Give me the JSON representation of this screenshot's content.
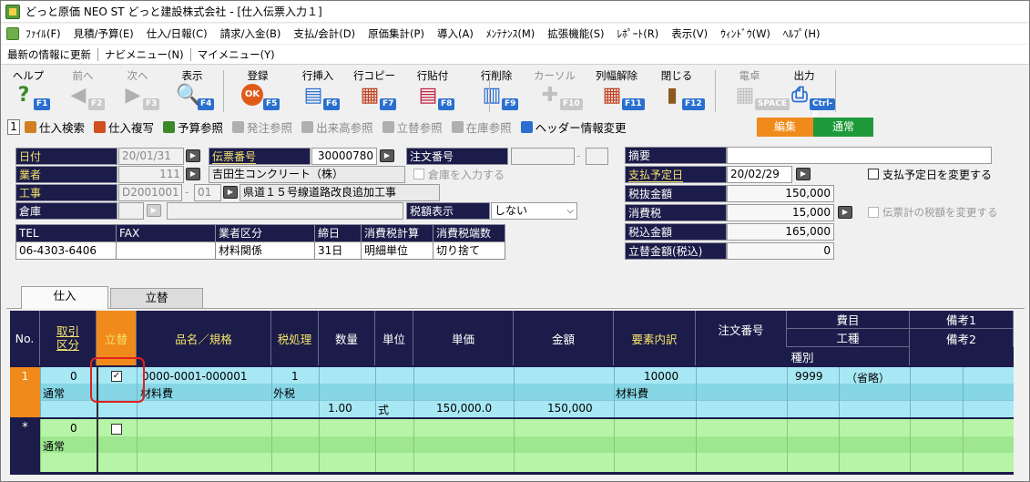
{
  "window": {
    "title": "どっと原価 NEO ST どっと建設株式会社 - [仕入伝票入力１]"
  },
  "menu": [
    "ﾌｧｲﾙ(F)",
    "見積/予算(E)",
    "仕入/日報(C)",
    "請求/入金(B)",
    "支払/会計(D)",
    "原価集計(P)",
    "導入(A)",
    "ﾒﾝﾃﾅﾝｽ(M)",
    "拡張機能(S)",
    "ﾚﾎﾟｰﾄ(R)",
    "表示(V)",
    "ｳｨﾝﾄﾞｳ(W)",
    "ﾍﾙﾌﾟ(H)"
  ],
  "links": [
    "最新の情報に更新",
    "ナビメニュー(N)",
    "マイメニュー(Y)"
  ],
  "toolbar": [
    {
      "label": "ヘルプ",
      "key": "F1",
      "icon": "?",
      "color": "#3a8a2a",
      "disabled": false
    },
    {
      "label": "前へ",
      "key": "F2",
      "icon": "◀",
      "color": "#b0b0b0",
      "disabled": true
    },
    {
      "label": "次へ",
      "key": "F3",
      "icon": "▶",
      "color": "#b0b0b0",
      "disabled": true
    },
    {
      "label": "表示",
      "key": "F4",
      "icon": "🔍",
      "color": "#2a6fcf",
      "disabled": false
    },
    {
      "label": "登録",
      "key": "F5",
      "icon": "OK",
      "color": "#e05a1a",
      "disabled": false
    },
    {
      "label": "行挿入",
      "key": "F6",
      "icon": "▤",
      "color": "#2a6fcf",
      "disabled": false
    },
    {
      "label": "行コピー",
      "key": "F7",
      "icon": "▦",
      "color": "#c04020",
      "disabled": false
    },
    {
      "label": "行貼付",
      "key": "F8",
      "icon": "▤",
      "color": "#c02040",
      "disabled": false
    },
    {
      "label": "行削除",
      "key": "F9",
      "icon": "▥",
      "color": "#2a6fcf",
      "disabled": false
    },
    {
      "label": "カーソル",
      "key": "F10",
      "icon": "✚",
      "color": "#c0c0c0",
      "disabled": true
    },
    {
      "label": "列幅解除",
      "key": "F11",
      "icon": "▦",
      "color": "#c04020",
      "disabled": false
    },
    {
      "label": "閉じる",
      "key": "F12",
      "icon": "▮",
      "color": "#8a5a20",
      "disabled": false
    },
    {
      "label": "電卓",
      "key": "SPACE",
      "icon": "▦",
      "color": "#c0c0c0",
      "disabled": true
    },
    {
      "label": "出力",
      "key": "Ctrl-P",
      "icon": "⎙",
      "color": "#2a6fcf",
      "disabled": false
    }
  ],
  "subtool": {
    "number": "1",
    "items": [
      {
        "label": "仕入検索",
        "disabled": false,
        "color": "#d08020"
      },
      {
        "label": "仕入複写",
        "disabled": false,
        "color": "#d05020"
      },
      {
        "label": "予算参照",
        "disabled": false,
        "color": "#3a8a2a"
      },
      {
        "label": "発注参照",
        "disabled": true,
        "color": "#b0b0b0"
      },
      {
        "label": "出来高参照",
        "disabled": true,
        "color": "#b0b0b0"
      },
      {
        "label": "立替参照",
        "disabled": true,
        "color": "#b0b0b0"
      },
      {
        "label": "在庫参照",
        "disabled": true,
        "color": "#b0b0b0"
      },
      {
        "label": "ヘッダー情報変更",
        "disabled": false,
        "color": "#2a6fcf"
      }
    ],
    "mode_edit": "編集",
    "mode_normal": "通常"
  },
  "header": {
    "date_label": "日付",
    "date": "20/01/31",
    "slip_label": "伝票番号",
    "slip": "30000780",
    "order_label": "注文番号",
    "order": "",
    "order_sep": "-",
    "vendor_label": "業者",
    "vendor_code": "111",
    "vendor_name": "吉田生コンクリート（株）",
    "warehouse_check_label": "倉庫を入力する",
    "work_label": "工事",
    "work_code": "D2001001",
    "work_sep": "-",
    "work_sub": "01",
    "work_name": "県道１５号線道路改良追加工事",
    "warehouse_label": "倉庫",
    "warehouse": "",
    "tax_display_label": "税額表示",
    "tax_display": "しない",
    "tel_label": "TEL",
    "tel": "06-4303-6406",
    "fax_label": "FAX",
    "fax": "",
    "cat_label": "業者区分",
    "cat": "材料関係",
    "close_label": "締日",
    "close": "31日",
    "taxcalc_label": "消費税計算",
    "taxcalc": "明細単位",
    "round_label": "消費税端数",
    "round": "切り捨て"
  },
  "summary": {
    "memo_label": "摘要",
    "memo": "",
    "paydate_label": "支払予定日",
    "paydate": "20/02/29",
    "paydate_change": "支払予定日を変更する",
    "net_label": "税抜金額",
    "net": "150,000",
    "tax_label": "消費税",
    "tax": "15,000",
    "tax_change": "伝票計の税額を変更する",
    "gross_label": "税込金額",
    "gross": "165,000",
    "advance_label": "立替金額(税込)",
    "advance": "0"
  },
  "tabs": [
    "仕入",
    "立替"
  ],
  "grid": {
    "headers": {
      "no": "No.",
      "kubun": "取引\n区分",
      "tatekae": "立替",
      "item": "品名／規格",
      "taxproc": "税処理",
      "qty": "数量",
      "unit": "単位",
      "price": "単価",
      "amount": "金額",
      "element": "要素内訳",
      "order": "注文番号",
      "cost": "費目",
      "process": "工種",
      "kind": "種別",
      "note1": "備考1",
      "note2": "備考2"
    },
    "rows": [
      {
        "no": "1",
        "kubun_code": "0",
        "kubun": "通常",
        "tatekae": "✓",
        "item_code": "0000-0001-000001",
        "item_name": "材料費",
        "tax_code": "1",
        "tax": "外税",
        "qty": "1.00",
        "unit": "式",
        "price": "150,000.0",
        "amount": "150,000",
        "element_code": "10000",
        "element": "材料費",
        "cost_code": "9999",
        "cost_note": "（省略）"
      },
      {
        "no": "*",
        "kubun_code": "0",
        "kubun": "通常",
        "tatekae": ""
      }
    ]
  },
  "colors": {
    "navy": "#1c1c4a",
    "row_active": "#a8e8f4",
    "row_new": "#b6f5a8",
    "orange": "#f08a1a",
    "green": "#1f9a3a"
  }
}
